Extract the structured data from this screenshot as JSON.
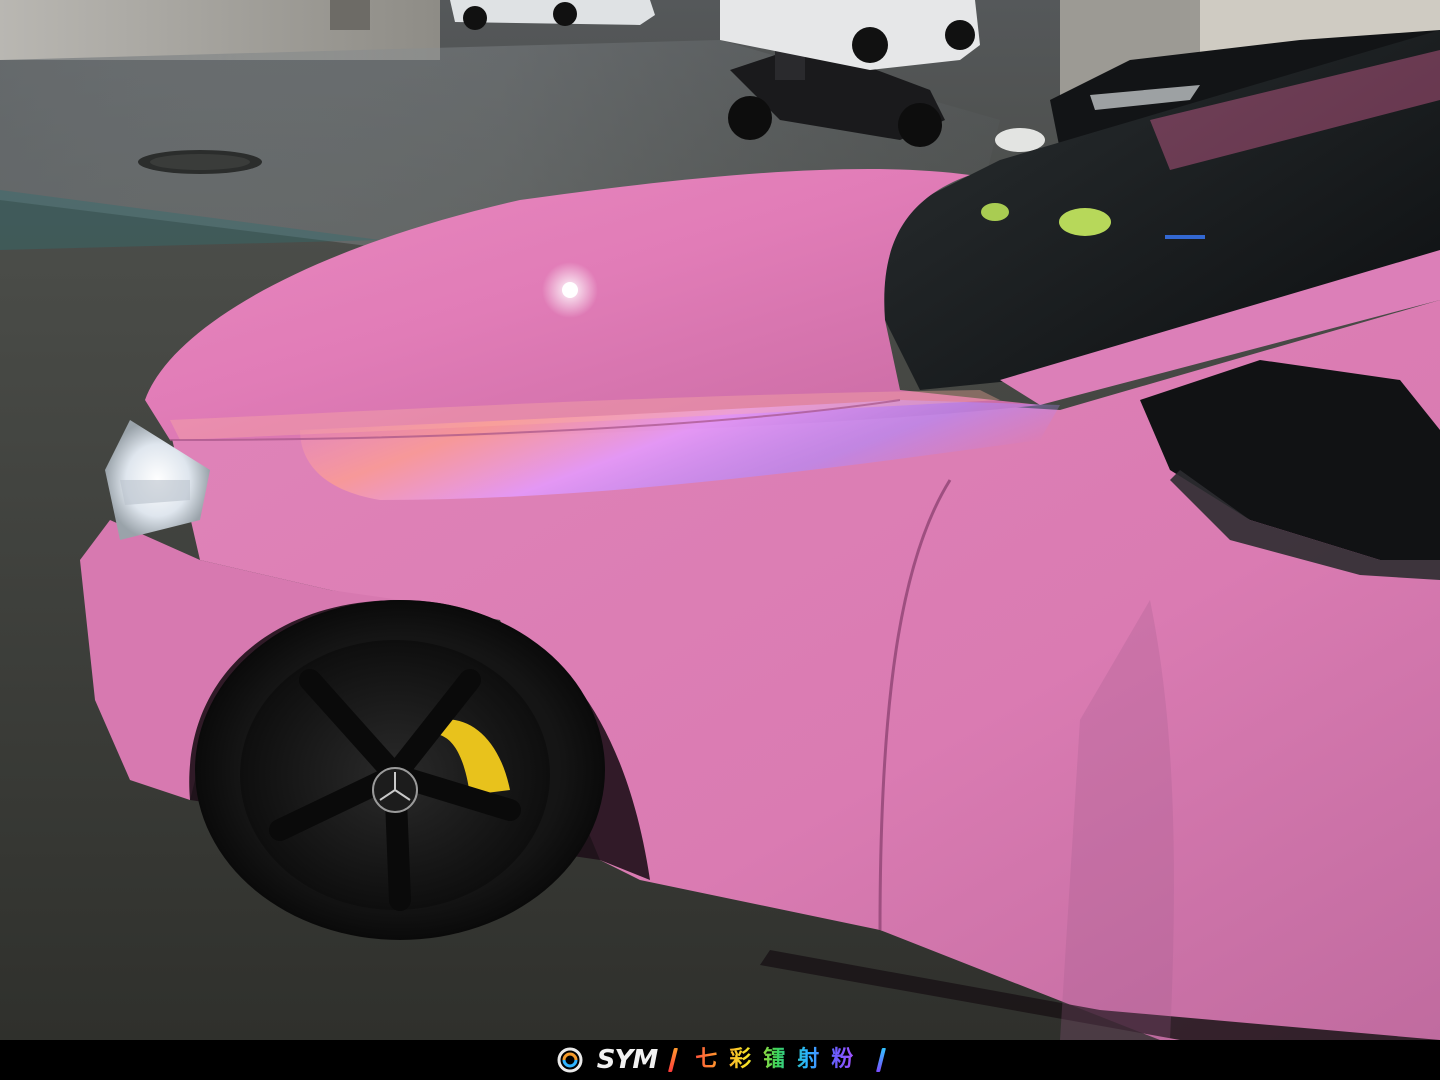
{
  "caption": {
    "brand": "SYM",
    "slogan": "七彩镭射粉",
    "colors": {
      "slogan_gradient": [
        "#ff4141",
        "#ff9b2c",
        "#f7e427",
        "#3bd35a",
        "#29b6ff",
        "#6d5cff",
        "#c04bff"
      ],
      "brand_text": "#f1f1f1",
      "bar_background": "#000000"
    },
    "icons": [
      "sym-logo-icon"
    ]
  },
  "scene": {
    "car_paint": "#e07fb6",
    "iridescent_sheen": [
      "#ff9bb3",
      "#d98aff",
      "#b88cff"
    ],
    "floor": "#3f403b",
    "caliper": "#e8c21c",
    "wheel": "#161616"
  }
}
